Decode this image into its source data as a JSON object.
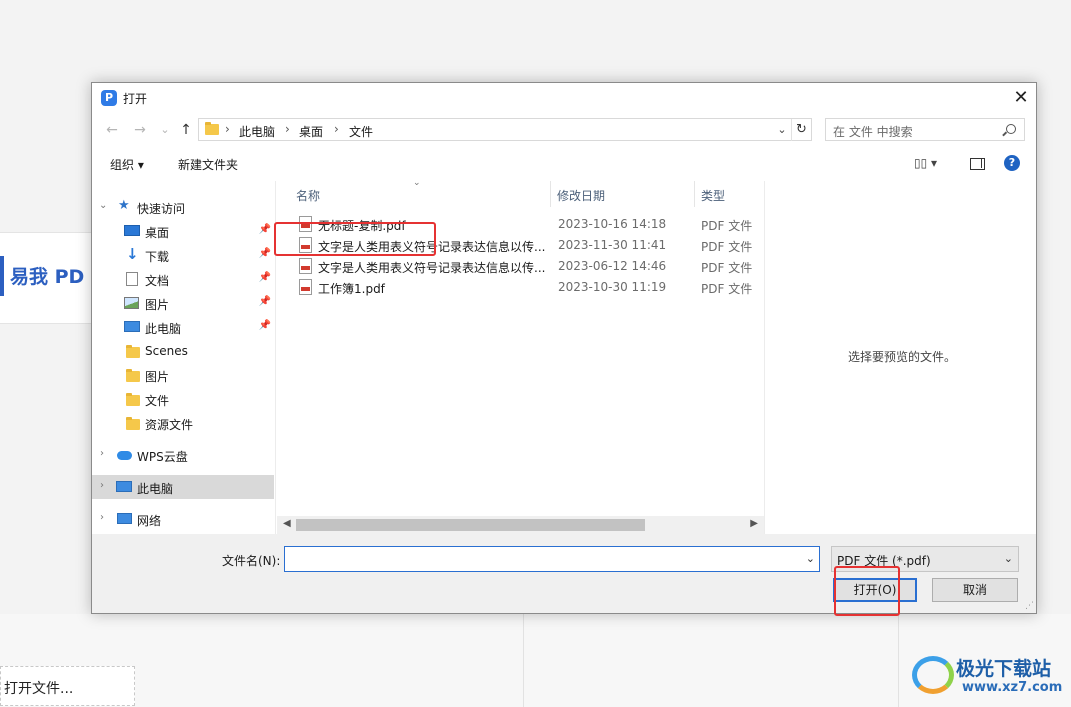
{
  "background": {
    "logo_text": "易我 PD",
    "open_file_label": "打开文件..."
  },
  "watermark": {
    "title": "极光下载站",
    "url": "www.xz7.com"
  },
  "dialog": {
    "title": "打开",
    "app_icon_letter": "P",
    "close_glyph": "✕",
    "nav": {
      "back": "←",
      "forward": "→",
      "recent": "⌄",
      "up": "↑"
    },
    "address": {
      "crumbs": [
        "此电脑",
        "桌面",
        "文件"
      ],
      "separator": "›",
      "dropdown": "⌄",
      "refresh": "↻"
    },
    "search": {
      "placeholder": "在 文件 中搜索"
    },
    "toolbar": {
      "organize": "组织 ▾",
      "new_folder": "新建文件夹",
      "view": "▯▯ ▾",
      "help": "?"
    },
    "nav_pane": {
      "quick_access": "快速访问",
      "items": [
        {
          "label": "桌面",
          "pinned": true
        },
        {
          "label": "下载",
          "pinned": true
        },
        {
          "label": "文档",
          "pinned": true
        },
        {
          "label": "图片",
          "pinned": true
        },
        {
          "label": "此电脑",
          "pinned": true
        },
        {
          "label": "Scenes",
          "pinned": false
        },
        {
          "label": "图片",
          "pinned": false
        },
        {
          "label": "文件",
          "pinned": false
        },
        {
          "label": "资源文件",
          "pinned": false
        }
      ],
      "wps_cloud": "WPS云盘",
      "this_pc": "此电脑",
      "network": "网络"
    },
    "file_list": {
      "columns": {
        "name": "名称",
        "modified": "修改日期",
        "type": "类型"
      },
      "files": [
        {
          "name": "无标题-复制.pdf",
          "modified": "2023-10-16 14:18",
          "type": "PDF 文件"
        },
        {
          "name": "文字是人类用表义符号记录表达信息以传...",
          "modified": "2023-11-30 11:41",
          "type": "PDF 文件"
        },
        {
          "name": "文字是人类用表义符号记录表达信息以传...",
          "modified": "2023-06-12 14:46",
          "type": "PDF 文件"
        },
        {
          "name": "工作簿1.pdf",
          "modified": "2023-10-30 11:19",
          "type": "PDF 文件"
        }
      ]
    },
    "preview_text": "选择要预览的文件。",
    "bottom": {
      "filename_label": "文件名(N):",
      "filename_value": "",
      "filter_value": "PDF 文件 (*.pdf)",
      "open_button": "打开(O)",
      "cancel_button": "取消"
    }
  },
  "colors": {
    "accent": "#2a6fd1",
    "highlight_red": "#e53232"
  }
}
